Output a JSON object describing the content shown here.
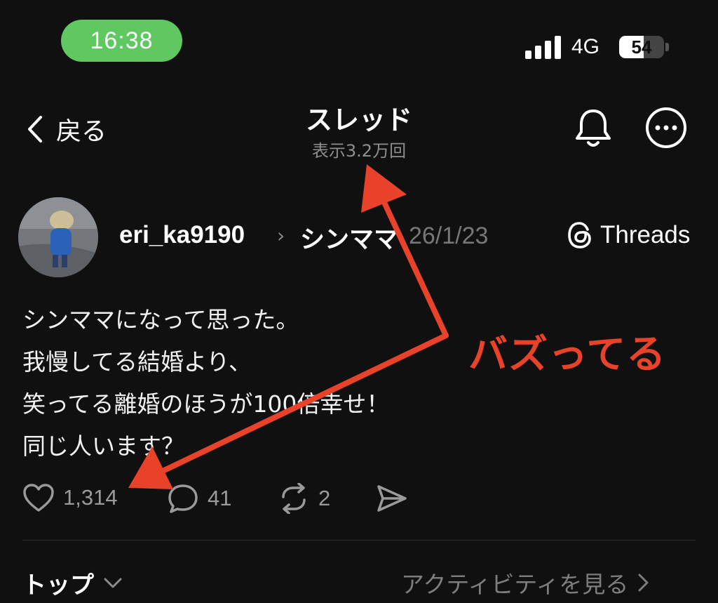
{
  "status_bar": {
    "time": "16:38",
    "network": "4G",
    "battery": "54",
    "battery_level": 0.54
  },
  "header": {
    "back_label": "戻る",
    "title": "スレッド",
    "subtitle": "表示3.2万回"
  },
  "post": {
    "username": "eri_ka9190",
    "community": "シンママ",
    "date": "26/1/23",
    "source_label": "Threads",
    "lines": [
      "シンママになって思った。",
      "我慢してる結婚より、",
      "笑ってる離婚のほうが100倍幸せ！",
      "同じ人います？"
    ],
    "likes": "1,314",
    "replies": "41",
    "reposts": "2"
  },
  "footer": {
    "sort_label": "トップ",
    "activity_label": "アクティビティを見る"
  },
  "annotation": {
    "label": "バズってる",
    "color": "#e8432a"
  },
  "icons": {
    "back": "chevron-left-icon",
    "bell": "bell-icon",
    "more": "more-horizontal-icon",
    "threads": "threads-logo-icon",
    "like": "heart-icon",
    "reply": "comment-icon",
    "repost": "repost-icon",
    "share": "send-icon"
  },
  "colors": {
    "background": "#101010",
    "time_pill": "#5fc860"
  }
}
